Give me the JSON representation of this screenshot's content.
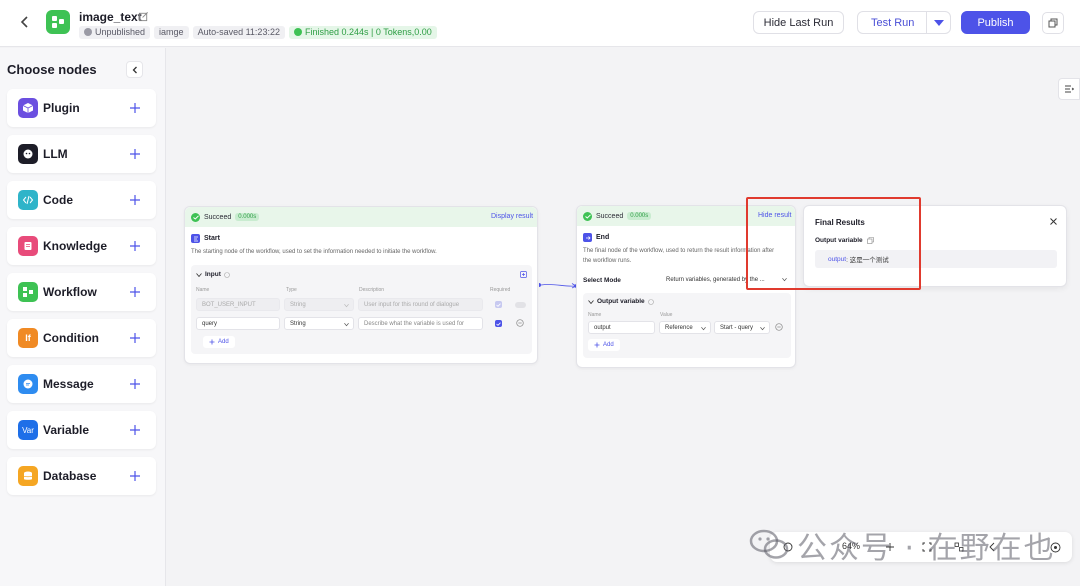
{
  "header": {
    "title": "image_text",
    "status": "Unpublished",
    "tag": "iamge",
    "autosave": "Auto-saved 11:23:22",
    "run_result": "Finished 0.244s | 0 Tokens,0.00",
    "hide_last_run": "Hide Last Run",
    "test_run": "Test Run",
    "publish": "Publish"
  },
  "sidebar": {
    "title": "Choose nodes",
    "items": [
      {
        "label": "Plugin",
        "icon": "plugin-icon",
        "color": "#6b4fe0"
      },
      {
        "label": "LLM",
        "icon": "llm-icon",
        "color": "#1d1d28"
      },
      {
        "label": "Code",
        "icon": "code-icon",
        "color": "#2fb4c9"
      },
      {
        "label": "Knowledge",
        "icon": "knowledge-icon",
        "color": "#e84b7a"
      },
      {
        "label": "Workflow",
        "icon": "workflow-icon",
        "color": "#3ec254"
      },
      {
        "label": "Condition",
        "icon": "condition-icon",
        "color": "#f08a24",
        "glyph": "If"
      },
      {
        "label": "Message",
        "icon": "message-icon",
        "color": "#2e8cf0"
      },
      {
        "label": "Variable",
        "icon": "variable-icon",
        "color": "#1e6fe8",
        "glyph": "Var"
      },
      {
        "label": "Database",
        "icon": "database-icon",
        "color": "#f5a623"
      }
    ]
  },
  "start_node": {
    "status": "Succeed",
    "time": "0.000s",
    "link": "Display result",
    "title": "Start",
    "description": "The starting node of the workflow, used to set the information needed to initiate the workflow.",
    "input_title": "Input",
    "columns": [
      "Name",
      "Type",
      "Description",
      "Required"
    ],
    "rows": [
      {
        "name": "BOT_USER_INPUT",
        "type": "String",
        "description": "User input for this round of dialogue",
        "disabled": true
      },
      {
        "name": "query",
        "type": "String",
        "description": "Describe what the variable is used for",
        "disabled": false
      }
    ],
    "add": "Add"
  },
  "end_node": {
    "status": "Succeed",
    "time": "0.000s",
    "link": "Hide result",
    "title": "End",
    "description": "The final node of the workflow, used to return the result information after the workflow runs.",
    "select_mode_label": "Select Mode",
    "select_mode_value": "Return variables, generated by the ...",
    "output_title": "Output variable",
    "columns": [
      "Name",
      "Value"
    ],
    "row": {
      "name": "output",
      "source": "Reference",
      "value": "Start - query"
    },
    "add": "Add"
  },
  "final_results": {
    "title": "Final Results",
    "label": "Output variable",
    "key": "output",
    "value": " : 这是一个测试"
  },
  "toolbar": {
    "zoom": "64%"
  },
  "watermark": {
    "text": "公众号 · 在野在也"
  }
}
